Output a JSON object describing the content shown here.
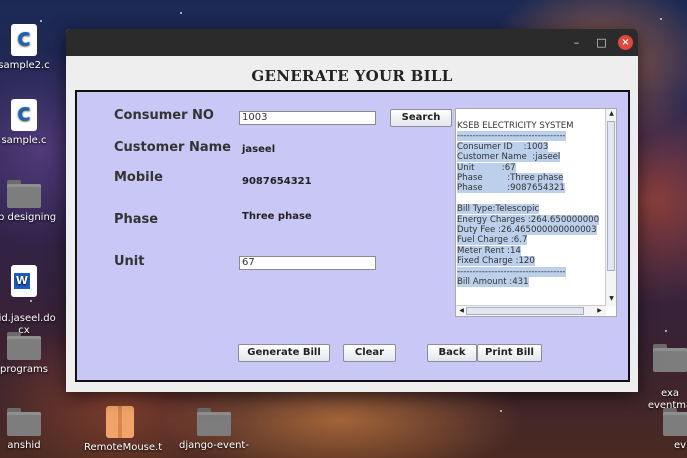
{
  "desktop": {
    "icons": [
      {
        "label": "sample2.c",
        "glyph": "C"
      },
      {
        "label": "sample.c",
        "glyph": "C"
      },
      {
        "label": "eb designing"
      },
      {
        "label": "hid.jaseel.do\ncx",
        "glyph": "W"
      },
      {
        "label": "programs"
      },
      {
        "label": "anshid"
      },
      {
        "label": "RemoteMouse.t"
      },
      {
        "label": "django-event-"
      },
      {
        "label": "exa\neventma"
      },
      {
        "label": "ev"
      }
    ]
  },
  "window": {
    "controls": {
      "minimize": "–",
      "maximize": "□",
      "close": "×"
    },
    "title": "GENERATE YOUR BILL"
  },
  "form": {
    "consumer_no_label": "Consumer NO",
    "consumer_no_value": "1003",
    "search_button": "Search",
    "customer_name_label": "Customer Name",
    "customer_name_value": "jaseel",
    "mobile_label": "Mobile",
    "mobile_value": "9087654321",
    "phase_label": "Phase",
    "phase_value": "Three phase",
    "unit_label": "Unit",
    "unit_value": "67"
  },
  "receipt": {
    "lines": [
      "KSEB ELECTRICITY SYSTEM",
      "-----------------------------------",
      "Consumer ID    :1003",
      "Customer Name  :jaseel",
      "Unit          :67",
      "Phase         :Three phase",
      "Phase         :9087654321",
      "",
      "Bill Type:Telescopic",
      "Energy Charges :264.650000000",
      "Duty Fee :26.465000000000003",
      "Fuel Charge :6.7",
      "Meter Rent :14",
      "Fixed Charge :120",
      "-----------------------------------",
      "Bill Amount :431"
    ]
  },
  "actions": {
    "generate_bill": "Generate Bill",
    "clear": "Clear",
    "back": "Back",
    "print_bill": "Print Bill"
  }
}
